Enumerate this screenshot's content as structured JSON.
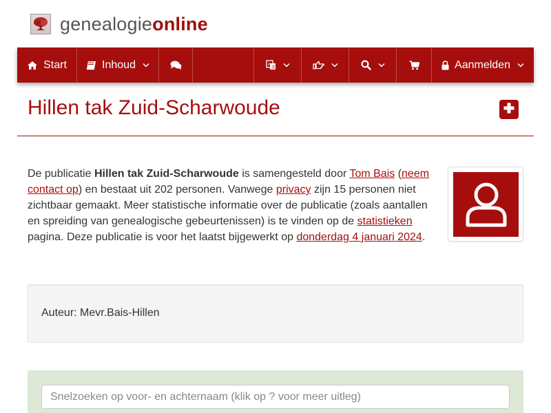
{
  "site": {
    "logo_part1": "genealogie",
    "logo_part2": "online",
    "logo_icon": "tree-icon"
  },
  "nav": {
    "start_label": "Start",
    "inhoud_label": "Inhoud",
    "login_label": "Aanmelden",
    "icons": [
      "home-icon",
      "book-icon",
      "comments-icon",
      "language-icon",
      "hand-pointer-icon",
      "search-icon",
      "cart-icon",
      "lock-icon"
    ]
  },
  "page": {
    "title": "Hillen tak Zuid-Scharwoude"
  },
  "intro": {
    "t1": "De publicatie ",
    "pub_name": "Hillen tak Zuid-Scharwoude",
    "t2": " is samengesteld door ",
    "author_link": "Tom Bais",
    "t3": " (",
    "contact_link": "neem contact op",
    "t4": ") en bestaat uit 202 personen. Vanwege ",
    "privacy_link": "privacy",
    "t5": " zijn 15 personen niet zichtbaar gemaakt. Meer statistische informatie over de publicatie (zoals aantallen en spreiding van genealogische gebeurtenissen) is te vinden op de ",
    "stats_link": "statistieken",
    "t6": " pagina. Deze publicatie is voor het laatst bijgewerkt op ",
    "date_link": "donderdag 4 januari 2024",
    "t7": "."
  },
  "author_box": {
    "text": "Auteur: Mevr.Bais-Hillen"
  },
  "search": {
    "placeholder": "Snelzoeken op voor- en achternaam (klik op ? voor meer uitleg)"
  },
  "colors": {
    "brand": "#a60e0e",
    "search_panel": "#dde8d7"
  }
}
